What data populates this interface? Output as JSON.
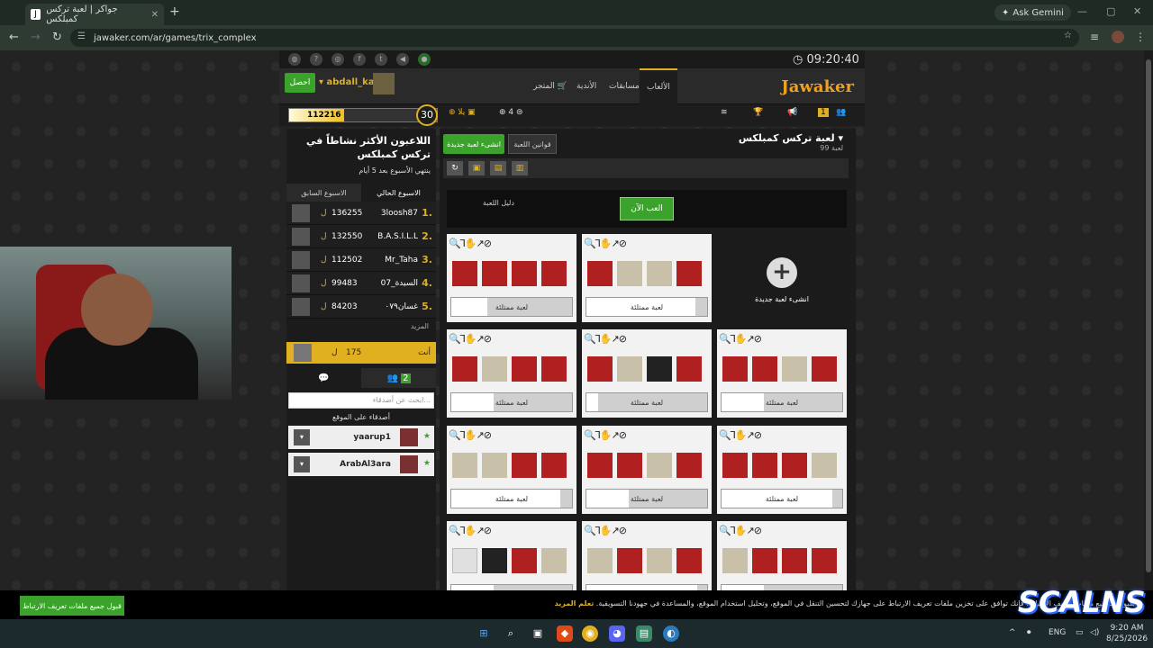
{
  "browser": {
    "tab_title": "جواكر | لعبة تركس كمبلكس",
    "tab_favicon": "J",
    "gemini": "Ask Gemini",
    "url": "jawaker.com/ar/games/trix_complex"
  },
  "site": {
    "clock": "09:20:40",
    "logo": "Jawaker",
    "nav": [
      "الألعاب",
      "مسابقات",
      "الأندية",
      "المتجر"
    ],
    "login": "احصل",
    "username": "abdall_kal",
    "xp_value": "112216",
    "xp_fill_fraction": 0.37,
    "level": "30",
    "coins": "يلا",
    "coins_count": "4",
    "notif_count": "1"
  },
  "leaders": {
    "title": "اللاعبون الأكثر نشاطاً في تركس كمبلكس",
    "subtitle": "ينتهي الأسبوع بعد 5 أيام",
    "tab_current": "الاسبوع الحالي",
    "tab_previous": "الاسبوع السابق",
    "rows": [
      {
        "rank": "1.",
        "name": "3loosh87",
        "score": "136255"
      },
      {
        "rank": "2.",
        "name": "B.A.S.I.L.L",
        "score": "132550"
      },
      {
        "rank": "3.",
        "name": "Mr_Taha",
        "score": "112502"
      },
      {
        "rank": "4.",
        "name": "السيدة_07",
        "score": "99483"
      },
      {
        "rank": "5.",
        "name": "غسان٠٧٩",
        "score": "84203"
      }
    ],
    "more": "المزيد",
    "you_label": "أنت",
    "you_score": "175",
    "currency": "ل"
  },
  "friends": {
    "count": "2",
    "search_placeholder": "ابحث عن أصدقاء...",
    "title": "أصدقاء على الموقع",
    "list": [
      {
        "name": "yaarup1"
      },
      {
        "name": "ArabAl3ara"
      }
    ]
  },
  "game": {
    "title": "لعبة تركس كمبلكس",
    "count": "99 لعبة",
    "new_game": "انشىء لعبة جديدة",
    "rules": "قوانين اللعبة",
    "play_now": "العب الآن",
    "guide": "دليل اللعبة",
    "create_label": "انشىء لعبة جديدة",
    "full_label": "لعبة ممتلئة",
    "icons": "🔍Ꞁ✋↗⊘"
  },
  "cookie": {
    "button": "قبول جميع ملفات تعريف الارتباط",
    "text": "بقبولك لجميع ملفات تعريف الارتباط، فإنك توافق على تخزين ملفات تعريف الارتباط على جهازك لتحسين التنقل في الموقع، وتحليل استخدام الموقع، والمساعدة في جهودنا التسويقية.",
    "learn": "تعلم المزيد"
  },
  "brand": "SCALNS",
  "taskbar": {
    "lang": "ENG",
    "time": "9:20 AM",
    "date": "8/25/2026"
  }
}
